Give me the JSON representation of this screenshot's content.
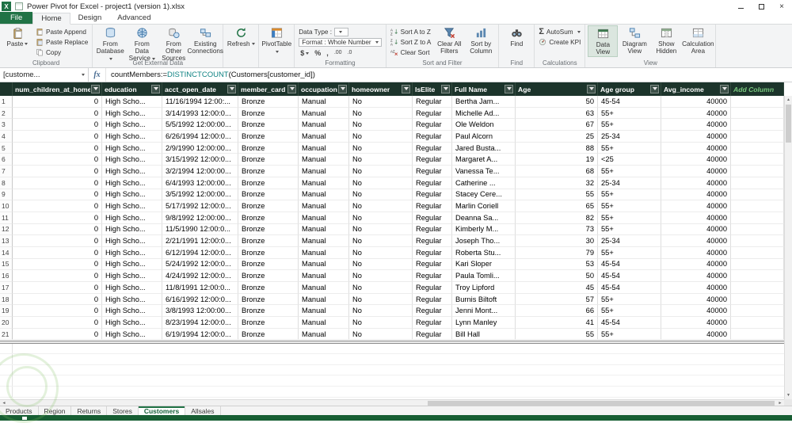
{
  "window": {
    "title": "Power Pivot for Excel - project1 (version 1).xlsx"
  },
  "tabs": {
    "file": "File",
    "home": "Home",
    "design": "Design",
    "advanced": "Advanced"
  },
  "ribbon": {
    "clipboard": {
      "label": "Clipboard",
      "paste": "Paste",
      "paste_append": "Paste Append",
      "paste_replace": "Paste Replace",
      "copy": "Copy"
    },
    "get_external_data": {
      "label": "Get External Data",
      "from_database": "From Database",
      "from_data_service": "From Data Service",
      "from_other_sources": "From Other Sources",
      "existing_connections": "Existing Connections"
    },
    "refresh": "Refresh",
    "pivottable": "PivotTable",
    "formatting": {
      "label": "Formatting",
      "data_type_label": "Data Type :",
      "format_label": "Format : Whole Number",
      "currency_symbol": "$",
      "percent_symbol": "%",
      "comma_symbol": ",",
      "increase_decimal_icon": ".00",
      "decrease_decimal_icon": ".0"
    },
    "sort_filter": {
      "label": "Sort and Filter",
      "sort_az": "Sort A to Z",
      "sort_za": "Sort Z to A",
      "clear_sort": "Clear Sort",
      "clear_all_filters": "Clear All Filters",
      "sort_by_column": "Sort by Column"
    },
    "find": {
      "label": "Find",
      "find": "Find"
    },
    "calculations": {
      "label": "Calculations",
      "autosum": "AutoSum",
      "create_kpi": "Create KPI"
    },
    "view": {
      "label": "View",
      "data_view": "Data View",
      "diagram_view": "Diagram View",
      "show_hidden": "Show Hidden",
      "calculation_area": "Calculation Area"
    }
  },
  "formula_bar": {
    "name_box": "[custome...",
    "fx": "fx",
    "formula_prefix": "countMembers:=",
    "formula_function": "DISTINCTCOUNT",
    "formula_suffix": "(Customers[customer_id])"
  },
  "grid": {
    "columns": [
      "num_children_at_home",
      "education",
      "acct_open_date",
      "member_card",
      "occupation",
      "homeowner",
      "IsElite",
      "Full Name",
      "Age",
      "Age group",
      "Avg_income"
    ],
    "add_column_label": "Add Column",
    "rows": [
      [
        "0",
        "High Scho...",
        "11/16/1994 12:00:...",
        "Bronze",
        "Manual",
        "No",
        "Regular",
        "Bertha Jam...",
        "50",
        "45-54",
        "40000"
      ],
      [
        "0",
        "High Scho...",
        "3/14/1993 12:00:0...",
        "Bronze",
        "Manual",
        "No",
        "Regular",
        "Michelle Ad...",
        "63",
        "55+",
        "40000"
      ],
      [
        "0",
        "High Scho...",
        "5/5/1992 12:00:00...",
        "Bronze",
        "Manual",
        "No",
        "Regular",
        "Ole Weldon",
        "67",
        "55+",
        "40000"
      ],
      [
        "0",
        "High Scho...",
        "6/26/1994 12:00:0...",
        "Bronze",
        "Manual",
        "No",
        "Regular",
        "Paul Alcorn",
        "25",
        "25-34",
        "40000"
      ],
      [
        "0",
        "High Scho...",
        "2/9/1990 12:00:00...",
        "Bronze",
        "Manual",
        "No",
        "Regular",
        "Jared Busta...",
        "88",
        "55+",
        "40000"
      ],
      [
        "0",
        "High Scho...",
        "3/15/1992 12:00:0...",
        "Bronze",
        "Manual",
        "No",
        "Regular",
        "Margaret A...",
        "19",
        "<25",
        "40000"
      ],
      [
        "0",
        "High Scho...",
        "3/2/1994 12:00:00...",
        "Bronze",
        "Manual",
        "No",
        "Regular",
        "Vanessa Te...",
        "68",
        "55+",
        "40000"
      ],
      [
        "0",
        "High Scho...",
        "6/4/1993 12:00:00...",
        "Bronze",
        "Manual",
        "No",
        "Regular",
        "Catherine ...",
        "32",
        "25-34",
        "40000"
      ],
      [
        "0",
        "High Scho...",
        "3/5/1992 12:00:00...",
        "Bronze",
        "Manual",
        "No",
        "Regular",
        "Stacey Cere...",
        "55",
        "55+",
        "40000"
      ],
      [
        "0",
        "High Scho...",
        "5/17/1992 12:00:0...",
        "Bronze",
        "Manual",
        "No",
        "Regular",
        "Marlin Coriell",
        "65",
        "55+",
        "40000"
      ],
      [
        "0",
        "High Scho...",
        "9/8/1992 12:00:00...",
        "Bronze",
        "Manual",
        "No",
        "Regular",
        "Deanna Sa...",
        "82",
        "55+",
        "40000"
      ],
      [
        "0",
        "High Scho...",
        "11/5/1990 12:00:0...",
        "Bronze",
        "Manual",
        "No",
        "Regular",
        "Kimberly M...",
        "73",
        "55+",
        "40000"
      ],
      [
        "0",
        "High Scho...",
        "2/21/1991 12:00:0...",
        "Bronze",
        "Manual",
        "No",
        "Regular",
        "Joseph Tho...",
        "30",
        "25-34",
        "40000"
      ],
      [
        "0",
        "High Scho...",
        "6/12/1994 12:00:0...",
        "Bronze",
        "Manual",
        "No",
        "Regular",
        "Roberta Stu...",
        "79",
        "55+",
        "40000"
      ],
      [
        "0",
        "High Scho...",
        "5/24/1992 12:00:0...",
        "Bronze",
        "Manual",
        "No",
        "Regular",
        "Kari Sloper",
        "53",
        "45-54",
        "40000"
      ],
      [
        "0",
        "High Scho...",
        "4/24/1992 12:00:0...",
        "Bronze",
        "Manual",
        "No",
        "Regular",
        "Paula Tomli...",
        "50",
        "45-54",
        "40000"
      ],
      [
        "0",
        "High Scho...",
        "11/8/1991 12:00:0...",
        "Bronze",
        "Manual",
        "No",
        "Regular",
        "Troy Lipford",
        "45",
        "45-54",
        "40000"
      ],
      [
        "0",
        "High Scho...",
        "6/16/1992 12:00:0...",
        "Bronze",
        "Manual",
        "No",
        "Regular",
        "Burnis Biltoft",
        "57",
        "55+",
        "40000"
      ],
      [
        "0",
        "High Scho...",
        "3/8/1993 12:00:00...",
        "Bronze",
        "Manual",
        "No",
        "Regular",
        "Jenni Mont...",
        "66",
        "55+",
        "40000"
      ],
      [
        "0",
        "High Scho...",
        "8/23/1994 12:00:0...",
        "Bronze",
        "Manual",
        "No",
        "Regular",
        "Lynn Manley",
        "41",
        "45-54",
        "40000"
      ],
      [
        "0",
        "High Scho...",
        "6/19/1994 12:00:0...",
        "Bronze",
        "Manual",
        "No",
        "Regular",
        "Bill Hall",
        "55",
        "55+",
        "40000"
      ]
    ]
  },
  "sheet_tabs": {
    "items": [
      "Products",
      "Region",
      "Returns",
      "Stores",
      "Customers",
      "Allsales"
    ],
    "active": "Customers"
  },
  "colors": {
    "accent_green": "#217346",
    "grid_header_bg": "#1c342b",
    "add_column_text": "#79c77e",
    "formula_function": "#0f8383",
    "status_bar": "#175e33"
  }
}
